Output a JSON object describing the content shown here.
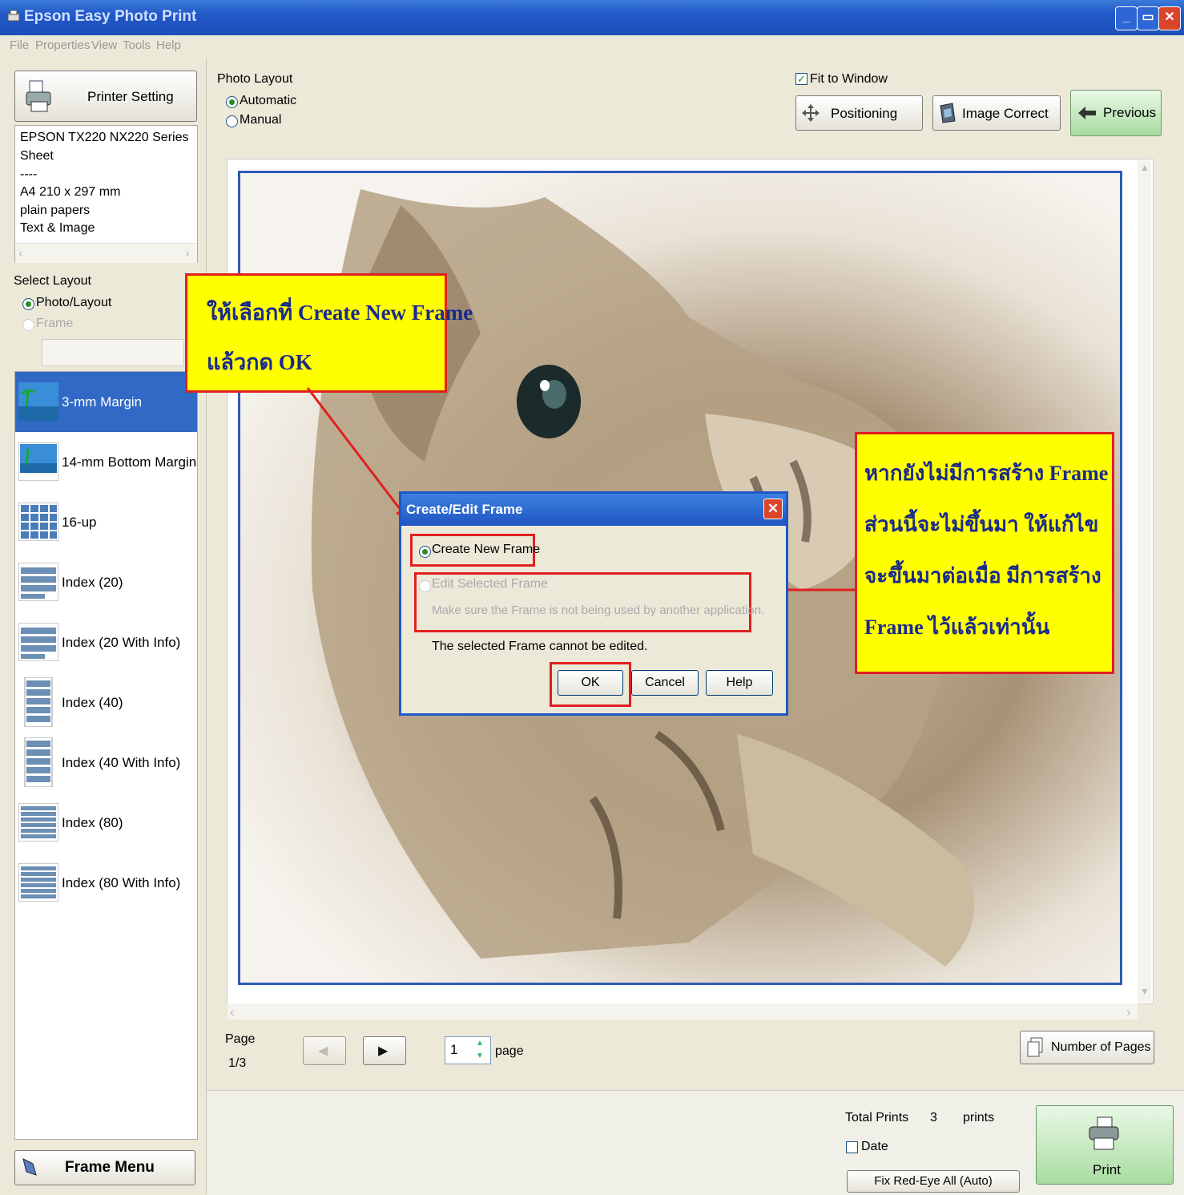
{
  "window": {
    "title": "Epson Easy Photo Print"
  },
  "menu": [
    "File",
    "Properties",
    "View",
    "Tools",
    "Help"
  ],
  "left_panel": {
    "printer_setting_label": "Printer Setting",
    "printer_info": [
      "EPSON TX220 NX220 Series",
      "Sheet",
      "----",
      "A4 210 x 297 mm",
      "plain papers",
      "Text & Image"
    ],
    "select_layout_label": "Select Layout",
    "photo_layout_option": "Photo/Layout",
    "frame_option": "Frame",
    "layouts": [
      "3-mm Margin",
      "14-mm Bottom Margin",
      "16-up",
      "Index (20)",
      "Index (20 With Info)",
      "Index (40)",
      "Index (40 With Info)",
      "Index (80)",
      "Index (80 With Info)"
    ],
    "frame_menu_label": "Frame Menu"
  },
  "top": {
    "photo_layout_label": "Photo Layout",
    "automatic_label": "Automatic",
    "manual_label": "Manual",
    "fit_to_window_label": "Fit to Window",
    "positioning_label": "Positioning",
    "image_correct_label": "Image Correct",
    "previous_label": "Previous"
  },
  "callouts": {
    "top_line1": "ให้เลือกที่ Create New Frame",
    "top_line2": "แล้วกด OK",
    "right_line1": "หากยังไม่มีการสร้าง Frame",
    "right_line2": "ส่วนนี้จะไม่ขึ้นมา ให้แก้ไข",
    "right_line3": "จะขึ้นมาต่อเมื่อ มีการสร้าง",
    "right_line4": "Frame ไว้แล้วเท่านั้น"
  },
  "dialog": {
    "title": "Create/Edit Frame",
    "create_new_label": "Create New Frame",
    "edit_selected_label": "Edit Selected Frame",
    "edit_note": "Make sure the Frame is not being used by another application.",
    "cannot_edit_msg": "The selected Frame cannot be edited.",
    "ok_label": "OK",
    "cancel_label": "Cancel",
    "help_label": "Help"
  },
  "pager": {
    "page_label": "Page",
    "page_fraction": "1/3",
    "page_value": "1",
    "page_unit": "page",
    "number_of_pages_label": "Number of Pages"
  },
  "bottom": {
    "total_prints_label": "Total Prints",
    "total_prints_value": "3",
    "prints_unit": "prints",
    "date_label": "Date",
    "fix_red_eye_label": "Fix Red-Eye All (Auto)",
    "print_label": "Print"
  }
}
